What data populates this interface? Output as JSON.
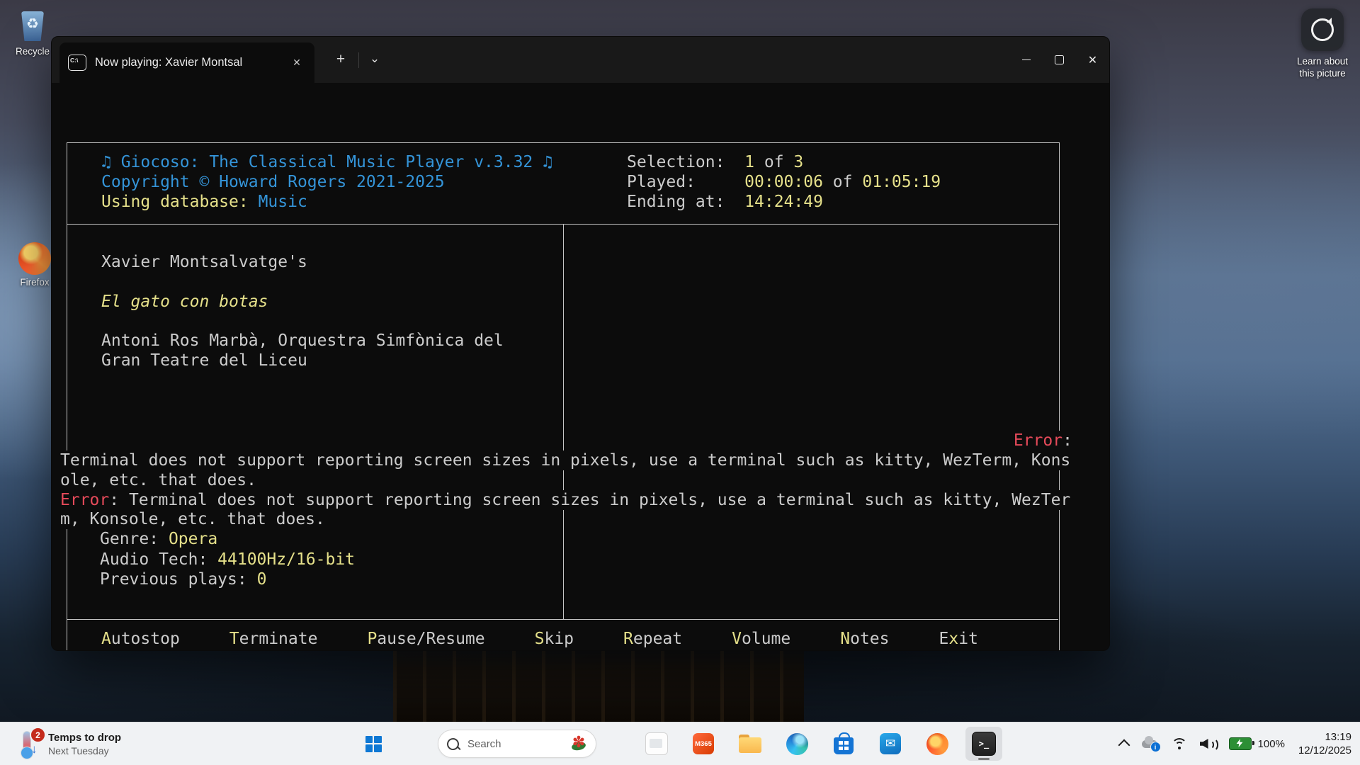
{
  "desktop": {
    "recycle_bin_label": "Recycle",
    "firefox_label": "Firefox",
    "learn_about_line1": "Learn about",
    "learn_about_line2": "this picture"
  },
  "window": {
    "tab_title": "Now playing: Xavier Montsal",
    "tab_icon_text": "C:\\",
    "icons": {
      "tab_close": "✕",
      "new_tab": "+",
      "tab_dropdown": "⌄",
      "close": "✕"
    }
  },
  "terminal": {
    "colors": {
      "background": "#0c0c0c",
      "foreground": "#cccccc",
      "blue": "#3494d8",
      "khaki": "#e5e08a",
      "error_red": "#e64a5a",
      "box_border": "#c4c4c4"
    },
    "header": {
      "title_line": "♫ Giocoso: The Classical Music Player v.3.32 ♫",
      "copyright_line": "Copyright © Howard Rogers 2021-2025",
      "db_label": "Using database: ",
      "db_value": "Music",
      "selection_label": "Selection:  ",
      "selection_current": "1",
      "selection_sep": " of ",
      "selection_total": "3",
      "played_label": "Played:     ",
      "played_elapsed": "00:00:06",
      "played_sep": " of ",
      "played_total": "01:05:19",
      "ending_label": "Ending at:  ",
      "ending_time": "14:24:49"
    },
    "now_playing": {
      "composer": "Xavier Montsalvatge's",
      "work_title": "El gato con botas",
      "performers_line1": "Antoni Ros Marbà, Orquestra Simfònica del",
      "performers_line2": "Gran Teatre del Liceu"
    },
    "errors": {
      "label": "Error",
      "label_colon": ":",
      "first_line1": "Terminal does not support reporting screen sizes in pixels, use a terminal such as kitty, WezTerm, Kons",
      "first_line2": "ole, etc. that does.",
      "second_rest1": ": Terminal does not support reporting screen sizes in pixels, use a terminal such as kitty, WezTer",
      "second_line2": "m, Konsole, etc. that does."
    },
    "details": {
      "genre_label": "Genre: ",
      "genre_value": "Opera",
      "audio_label": "Audio Tech: ",
      "audio_value": "44100Hz/16-bit",
      "plays_label": "Previous plays: ",
      "plays_value": "0"
    },
    "menu": [
      {
        "hot": "A",
        "rest": "utostop"
      },
      {
        "hot": "T",
        "rest": "erminate"
      },
      {
        "hot": "P",
        "rest": "ause/Resume"
      },
      {
        "hot": "S",
        "rest": "kip"
      },
      {
        "hot": "R",
        "rest": "epeat"
      },
      {
        "hot": "V",
        "rest": "olume"
      },
      {
        "hot": "N",
        "rest": "otes"
      },
      {
        "pre": "E",
        "hot": "x",
        "rest": "it"
      }
    ]
  },
  "taskbar": {
    "weather": {
      "badge": "2",
      "headline": "Temps to drop",
      "subline": "Next Tuesday"
    },
    "search_placeholder": "Search",
    "m365_label": "M365",
    "apps": [
      "white-window",
      "microsoft-365",
      "file-explorer",
      "edge",
      "microsoft-store",
      "outlook",
      "firefox",
      "terminal"
    ],
    "tray": {
      "battery_percent": "100%",
      "time": "13:19",
      "date": "12/12/2025"
    }
  }
}
